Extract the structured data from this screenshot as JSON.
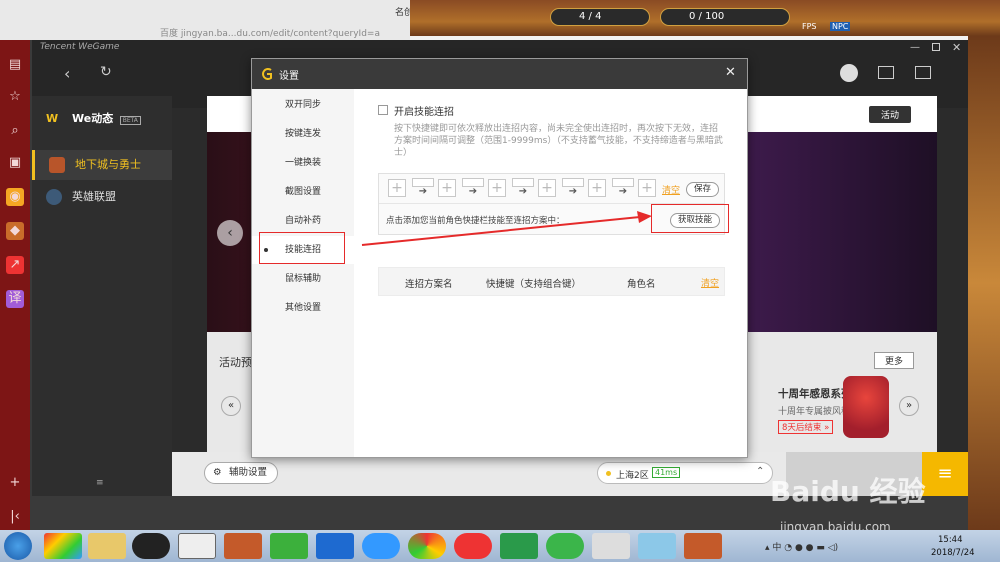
{
  "browser": {
    "url_fragment": "百度 jingyan.ba...du.com/edit/content?queryId=a",
    "tab_label": "名创"
  },
  "game_hud": {
    "count_a": "4 / 4",
    "count_b": "0 / 100",
    "fps_label": "FPS",
    "npc_label": "NPC"
  },
  "wegame": {
    "brand": "Tencent WeGame",
    "sidebar": [
      {
        "label": "We动态",
        "badge": "BETA"
      },
      {
        "label": "地下城与勇士"
      },
      {
        "label": "英雄联盟"
      }
    ],
    "banner_tag": "活动",
    "section_title": "活动预",
    "more_label": "更多",
    "promo_title": "十周年感恩系列活动",
    "promo_sub": "十周年专属披风称号",
    "promo_link": "8天后结束 »",
    "assist_button": "辅助设置",
    "server": "上海2区",
    "ping": "41ms"
  },
  "dialog": {
    "title": "设置",
    "nav": [
      {
        "label": "双开同步"
      },
      {
        "label": "按键连发"
      },
      {
        "label": "一键换装"
      },
      {
        "label": "截图设置"
      },
      {
        "label": "自动补药"
      },
      {
        "label": "技能连招"
      },
      {
        "label": "鼠标辅助"
      },
      {
        "label": "其他设置"
      }
    ],
    "active_nav_index": 5,
    "enable_label": "开启技能连招",
    "description": "按下快捷键即可依次释放出连招内容，尚未完全使出连招时，再次按下无效，连招方案时间间隔可调整（范围1-9999ms）（不支持蓄气技能，不支持缔造者与黑暗武士）",
    "clear_label": "清空",
    "save_label": "保存",
    "hint": "点击添加您当前角色快捷栏技能至连招方案中：",
    "fetch_skills_label": "获取技能",
    "table_headers": [
      "连招方案名",
      "快捷键（支持组合键）",
      "角色名"
    ],
    "table_clear_label": "清空"
  },
  "taskbar": {
    "time": "15:44",
    "date": "2018/7/24"
  },
  "watermark": {
    "main": "Baidu 经验",
    "sub": "jingyan.baidu.com"
  },
  "colors": {
    "accent": "#f0c020",
    "orange": "#f0a020",
    "annotation": "#e52a2a"
  }
}
